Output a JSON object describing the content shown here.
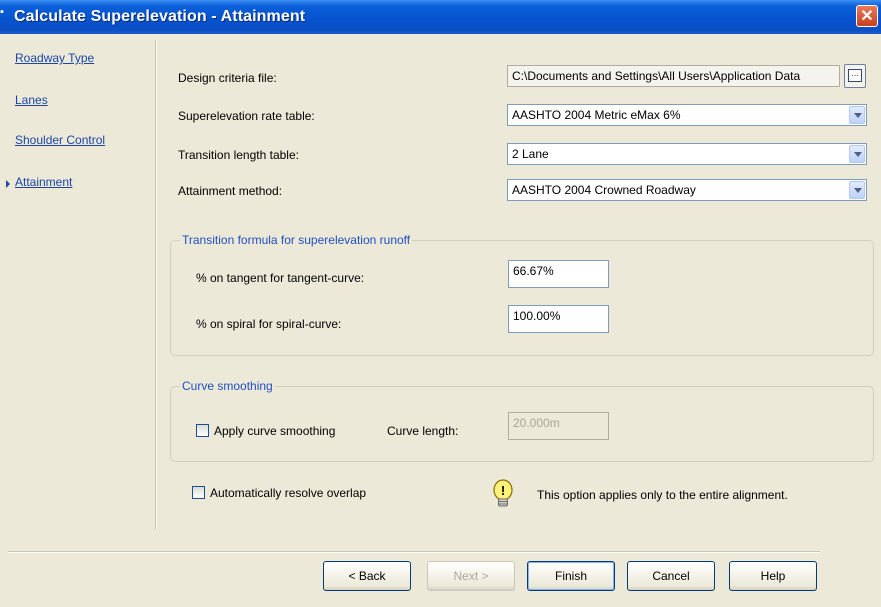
{
  "window": {
    "title": "Calculate Superelevation - Attainment",
    "close_glyph": "✕"
  },
  "nav": {
    "items": [
      {
        "label": "Roadway Type"
      },
      {
        "label": "Lanes"
      },
      {
        "label": "Shoulder Control"
      },
      {
        "label": "Attainment",
        "active": true
      }
    ]
  },
  "form": {
    "design_criteria": {
      "label": "Design criteria file:",
      "value": "C:\\Documents and Settings\\All Users\\Application Data",
      "browse_icon": "ellipsis-icon"
    },
    "rate_table": {
      "label": "Superelevation rate table:",
      "value": "AASHTO 2004 Metric eMax 6%"
    },
    "transition_table": {
      "label": "Transition length table:",
      "value": "2 Lane"
    },
    "attainment_method": {
      "label": "Attainment method:",
      "value": "AASHTO 2004 Crowned Roadway"
    }
  },
  "transition_formula": {
    "legend": "Transition formula for superelevation runoff",
    "tangent": {
      "label": "% on tangent for tangent-curve:",
      "value": "66.67%"
    },
    "spiral": {
      "label": "% on spiral for spiral-curve:",
      "value": "100.00%"
    }
  },
  "curve_smoothing": {
    "legend": "Curve smoothing",
    "apply": {
      "label": "Apply curve smoothing",
      "checked": false
    },
    "length": {
      "label": "Curve length:",
      "value": "20.000m",
      "enabled": false
    }
  },
  "overlap": {
    "label": "Automatically resolve overlap",
    "checked": false
  },
  "info": {
    "icon": "lightbulb-icon",
    "text": "This option applies only to the entire alignment."
  },
  "buttons": {
    "back": "< Back",
    "next": "Next >",
    "finish": "Finish",
    "cancel": "Cancel",
    "help": "Help"
  },
  "colors": {
    "title_bar": "#0a5fd8",
    "link": "#1c46a6",
    "group_legend": "#1f4fc2",
    "dialog_bg": "#ece9d8"
  }
}
